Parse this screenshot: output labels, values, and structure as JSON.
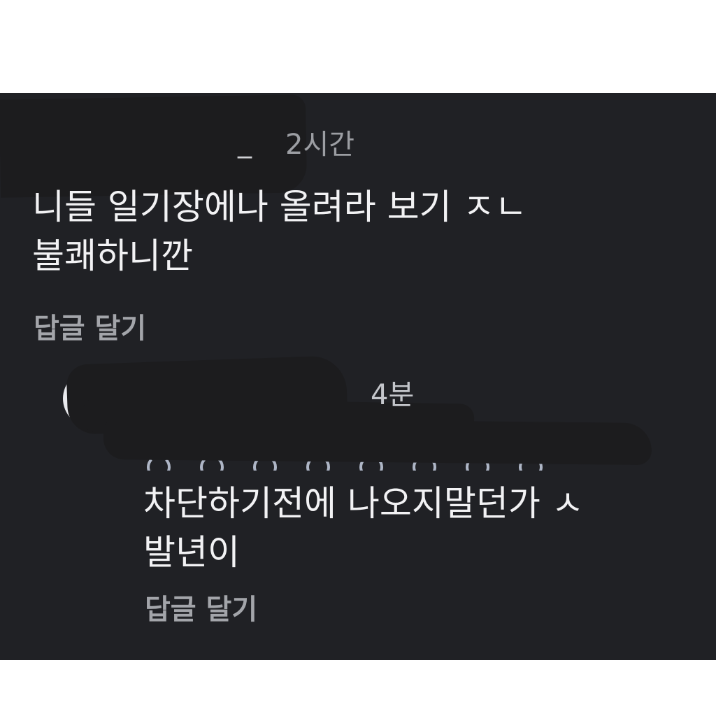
{
  "comments": [
    {
      "author_suffix": "_",
      "time": "2시간",
      "text": "니들 일기장에나 올려라 보기 ㅈㄴ\n불쾌하니깐",
      "reply_label": "답글 달기"
    },
    {
      "time": "4분",
      "text": "차단하기전에 나오지말던가 ㅅ\n발년이",
      "reply_label": "답글 달기"
    }
  ],
  "colors": {
    "background": "#202125",
    "primary_text": "#f2f2f4",
    "secondary_text": "#9c9ea3",
    "redaction": "#1c1c1e"
  }
}
